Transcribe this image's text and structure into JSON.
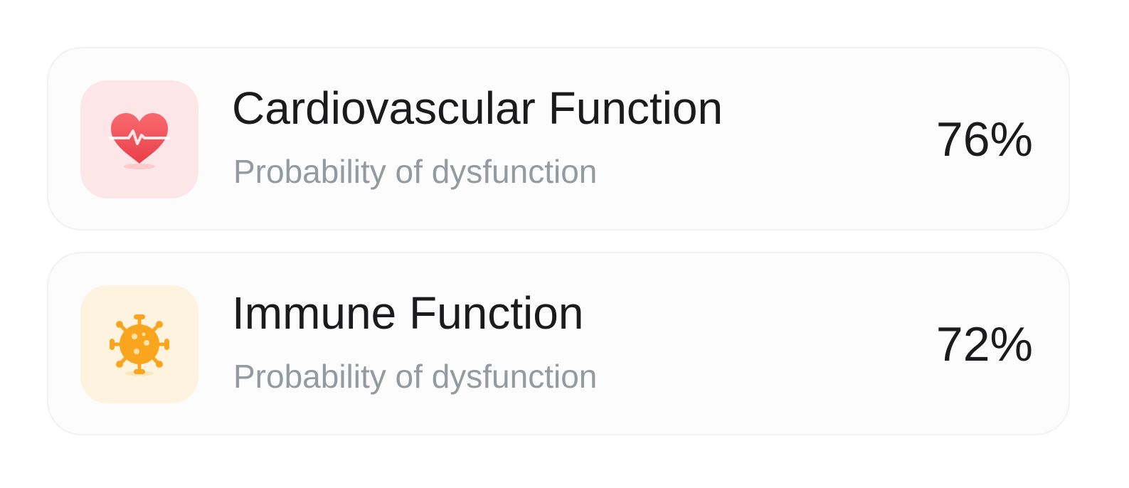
{
  "metrics": [
    {
      "title": "Cardiovascular Function",
      "subtitle": "Probability of dysfunction",
      "value": "76%",
      "icon": "heart-pulse-icon",
      "tile_color": "#fde6e7",
      "icon_color": "#f2545b"
    },
    {
      "title": "Immune Function",
      "subtitle": "Probability of dysfunction",
      "value": "72%",
      "icon": "virus-icon",
      "tile_color": "#fef3de",
      "icon_color": "#f9a51d"
    }
  ]
}
